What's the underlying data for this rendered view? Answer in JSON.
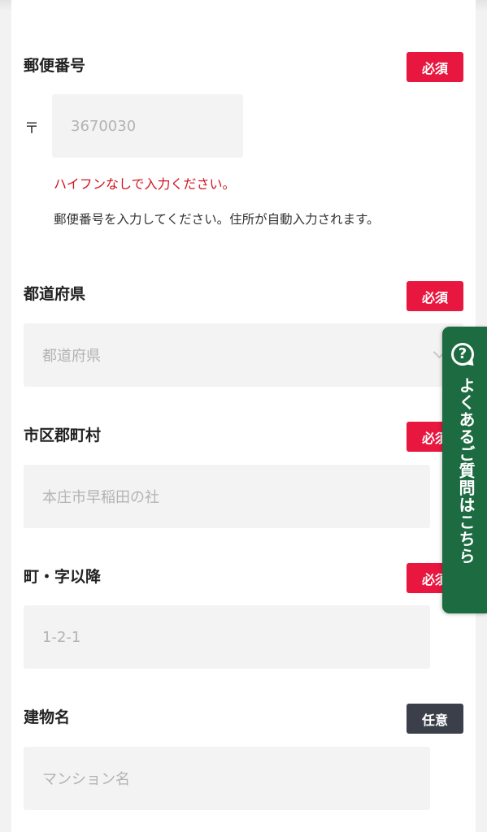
{
  "postal": {
    "label": "郵便番号",
    "badge": "必須",
    "mark": "〒",
    "placeholder": "3670030",
    "error": "ハイフンなしで入力ください。",
    "help": "郵便番号を入力してください。住所が自動入力されます。"
  },
  "prefecture": {
    "label": "都道府県",
    "badge": "必須",
    "placeholder": "都道府県"
  },
  "city": {
    "label": "市区郡町村",
    "badge": "必須",
    "placeholder": "本庄市早稲田の社"
  },
  "street": {
    "label": "町・字以降",
    "badge": "必須",
    "placeholder": "1-2-1"
  },
  "building": {
    "label": "建物名",
    "badge": "任意",
    "placeholder": "マンション名"
  },
  "faq": {
    "label": "よくあるご質問はこちら",
    "icon": "?"
  },
  "colors": {
    "required": "#e8173f",
    "optional": "#3b3f4a",
    "error": "#d2141e",
    "faq": "#1c6b41"
  },
  "icons": {
    "dropdown": "chevron-down-icon",
    "faq": "question-bubble-icon"
  }
}
